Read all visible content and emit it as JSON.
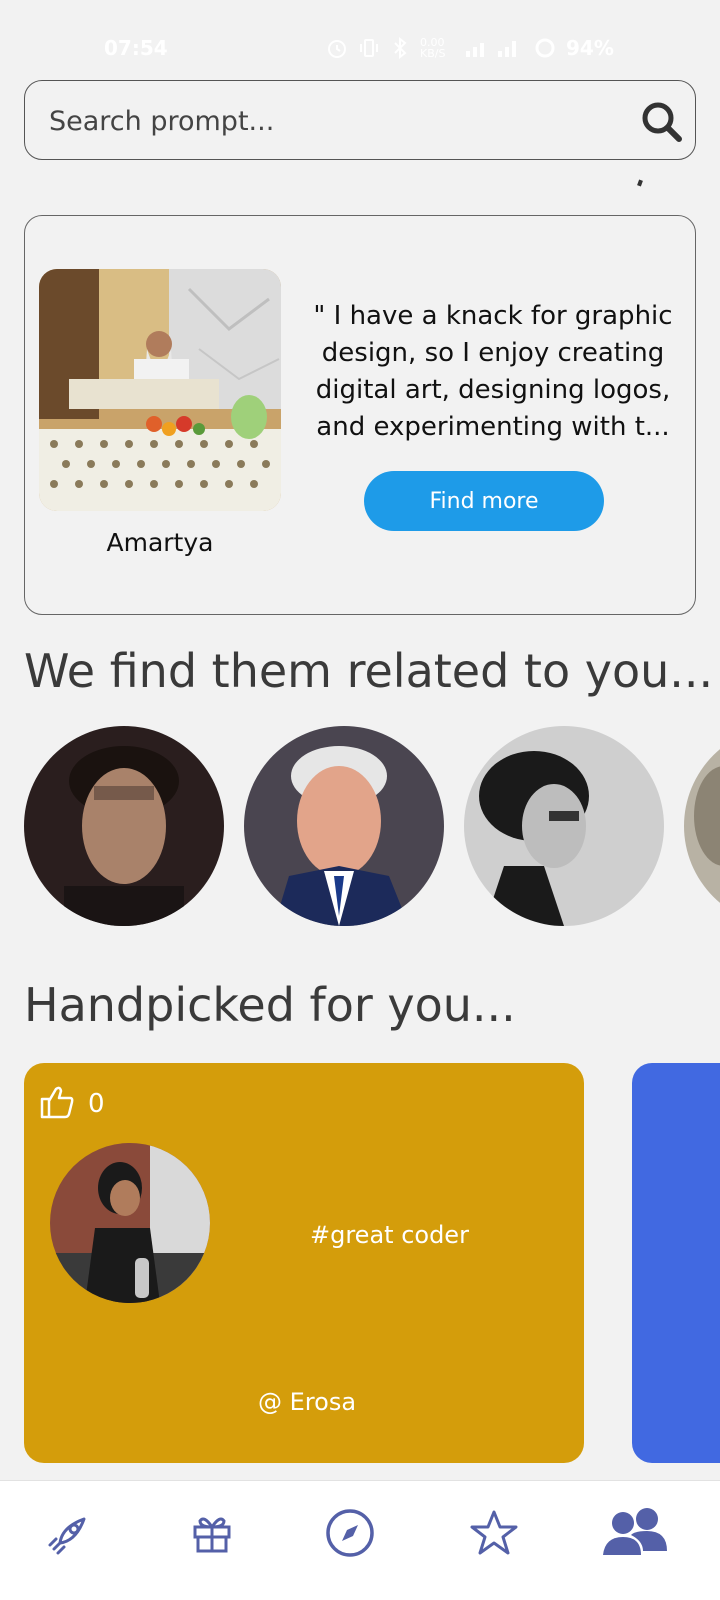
{
  "status_bar": {
    "time": "07:54",
    "network_speed": "0.00 KB/S",
    "battery": "94%"
  },
  "search": {
    "placeholder": "Search prompt..."
  },
  "feature": {
    "name": "Amartya",
    "quote": "\" I have a knack for graphic design, so I enjoy creating digital art, designing logos, and experimenting with t...",
    "button_label": "Find more"
  },
  "related": {
    "title": "We find them related to you..."
  },
  "handpicked": {
    "title": "Handpicked for you...",
    "cards": [
      {
        "likes": "0",
        "tag": "#great coder",
        "user": "@ Erosa",
        "color": "#d49d0b"
      },
      {
        "color": "#4169e1"
      }
    ]
  },
  "nav": {
    "items": [
      "rocket-icon",
      "gift-icon",
      "compass-icon",
      "star-icon",
      "people-icon"
    ],
    "active_color": "#5460a8"
  },
  "colors": {
    "accent": "#1e9be8",
    "background": "#f2f2f2"
  }
}
